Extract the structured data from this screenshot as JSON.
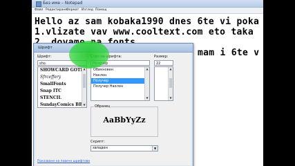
{
  "notepad": {
    "title": "Без име – Notepad",
    "menu": [
      "Файл",
      "Редактиране",
      "Формат",
      "Изглед",
      "Помощ"
    ],
    "lines": [
      "Hello az sam kobaka1990 dnes 6te vi poka",
      "1.vlizate vav www.cooltext.com eto taka",
      "2. dovame na fonts",
      "mam i 6te v"
    ]
  },
  "font_dialog": {
    "title": "Шрифт",
    "font_label": "Шрифт:",
    "font_value": "sho",
    "font_items": [
      "SHOWCARD GOTHIC",
      "Sfrceffery",
      "SmallFonts",
      "Snap ITC",
      "STENCIL",
      "SundayComics BB"
    ],
    "selected_font_index": 0,
    "style_label": "Стил на шрифта:",
    "style_value": "Получер",
    "style_items": [
      "Обикновен",
      "Наклон",
      "Получер",
      "Получер Наклон"
    ],
    "selected_style_index": 2,
    "size_label": "Размер:",
    "size_value": "22",
    "sample_label": "Образец",
    "sample_text": "AaBbYyZz",
    "script_label": "Скрипт:",
    "script_value": "западен",
    "more_fonts_link": "Показване на повече шрифтове"
  }
}
